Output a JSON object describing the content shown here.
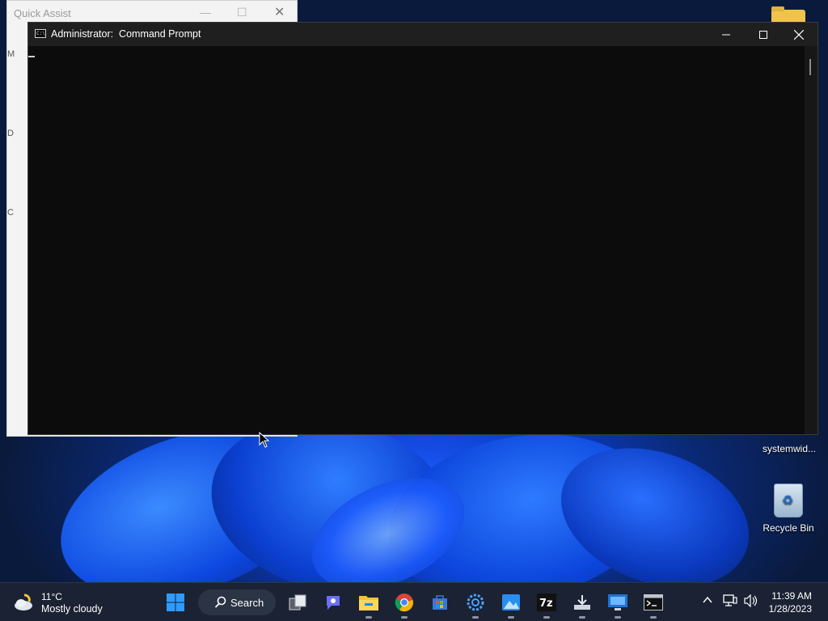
{
  "quick_assist": {
    "title": "Quick Assist",
    "edge_letters": [
      "M",
      "D",
      "C"
    ]
  },
  "cmd_window": {
    "title": "Administrator:  Command Prompt",
    "minimize_icon": "minimize-icon",
    "maximize_icon": "maximize-icon",
    "close_icon": "close-icon"
  },
  "desktop": {
    "icons": [
      {
        "label": "systemwid...",
        "icon": "folder-icon"
      },
      {
        "label": "Recycle Bin",
        "icon": "recycle-bin-icon"
      }
    ]
  },
  "taskbar": {
    "weather": {
      "temp": "11°C",
      "condition": "Mostly cloudy",
      "icon": "cloudy-weather-icon"
    },
    "search_label": "Search",
    "apps": [
      "start",
      "search",
      "task-view",
      "chat",
      "file-explorer",
      "chrome",
      "store",
      "settings",
      "photos",
      "7zip",
      "installer",
      "remote-desktop",
      "command-prompt"
    ],
    "clock": {
      "time": "11:39 AM",
      "date": "1/28/2023"
    }
  },
  "colors": {
    "cmd_background": "#0c0c0c",
    "cmd_titlebar": "#1f1f1f",
    "taskbar": "#1a2233",
    "accent": "#1e5cff"
  }
}
